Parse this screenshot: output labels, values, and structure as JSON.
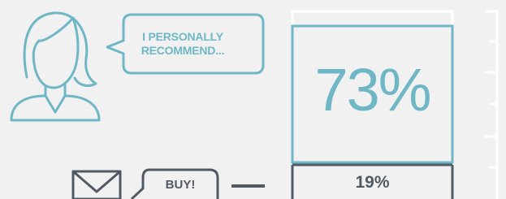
{
  "speech_bubble": {
    "text_line1": "I PERSONALLY",
    "text_line2": "RECOMMEND..."
  },
  "stat_top": {
    "value": "73%"
  },
  "stat_bottom": {
    "value": "19%"
  },
  "buy_bubble": {
    "text": "BUY!"
  },
  "icons": [
    "woman-avatar-icon",
    "envelope-icon"
  ],
  "colors": {
    "accent": "#6fb7c4",
    "dark": "#505a64",
    "light_line": "#ffffff",
    "background": "#f1f1f2"
  }
}
